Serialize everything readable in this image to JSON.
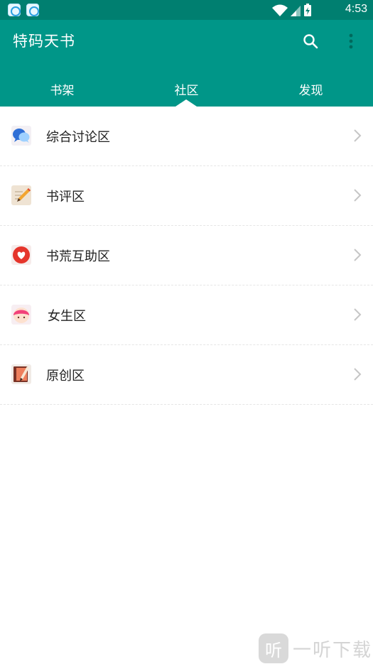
{
  "status_bar": {
    "time": "4:53",
    "notification_icons": [
      "app-notification-icon",
      "app-notification-icon"
    ],
    "status_icons": [
      "wifi-icon",
      "signal-icon",
      "battery-charging-icon"
    ]
  },
  "app_bar": {
    "title": "特码天书",
    "actions": [
      "search-icon",
      "more-vert-icon"
    ],
    "color": "#009688"
  },
  "tabs": [
    {
      "label": "书架",
      "selected": false
    },
    {
      "label": "社区",
      "selected": true
    },
    {
      "label": "发现",
      "selected": false
    }
  ],
  "community_list": [
    {
      "label": "综合讨论区",
      "icon": "chat-bubbles-icon"
    },
    {
      "label": "书评区",
      "icon": "pencil-note-icon"
    },
    {
      "label": "书荒互助区",
      "icon": "heart-icon"
    },
    {
      "label": "女生区",
      "icon": "girl-face-icon"
    },
    {
      "label": "原创区",
      "icon": "book-pen-icon"
    }
  ],
  "watermark": {
    "logo_glyph": "听",
    "text": "一听下载"
  }
}
